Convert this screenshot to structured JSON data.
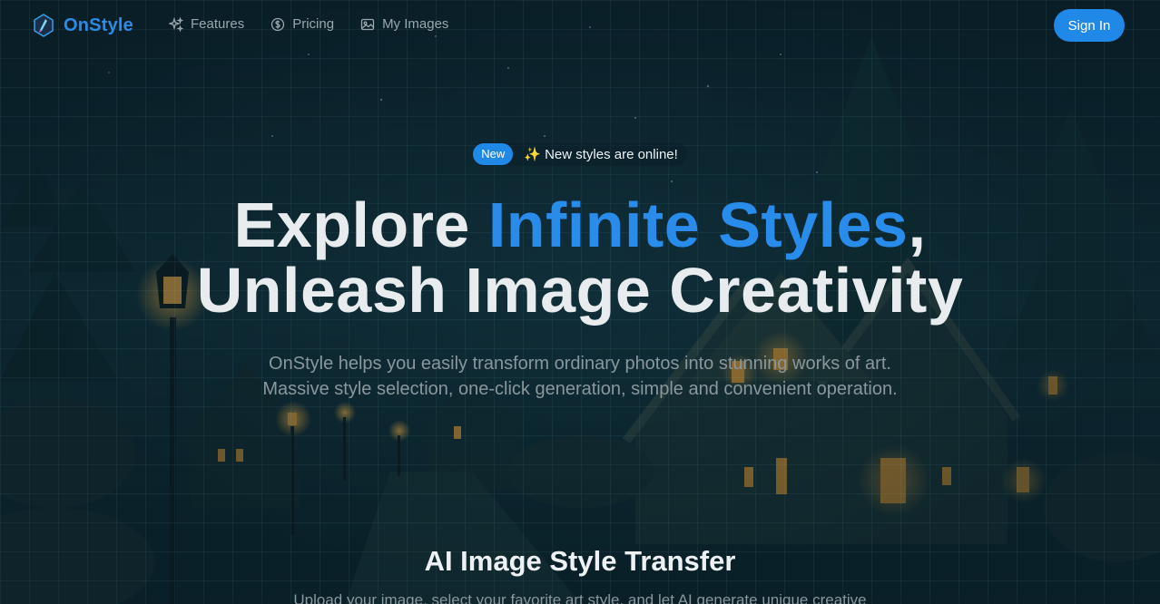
{
  "nav": {
    "brand": "OnStyle",
    "links": [
      {
        "label": "Features",
        "icon": "sparkles-icon"
      },
      {
        "label": "Pricing",
        "icon": "coin-icon"
      },
      {
        "label": "My Images",
        "icon": "image-icon"
      }
    ],
    "signin_label": "Sign In"
  },
  "hero": {
    "badge_label": "New",
    "badge_text": "✨ New styles are online!",
    "headline_part1": "Explore ",
    "headline_accent": "Infinite Styles",
    "headline_comma": ",",
    "headline_line2": "Unleash Image Creativity",
    "subtitle_line1": "OnStyle helps you easily transform ordinary photos into stunning works of art.",
    "subtitle_line2": "Massive style selection, one-click generation, simple and convenient operation."
  },
  "section": {
    "title": "AI Image Style Transfer",
    "description": "Upload your image, select your favorite art style, and let AI generate unique creative"
  },
  "colors": {
    "accent": "#2089e8",
    "background": "#0b1e26",
    "text": "#e9ecee",
    "muted": "#8a979d"
  }
}
